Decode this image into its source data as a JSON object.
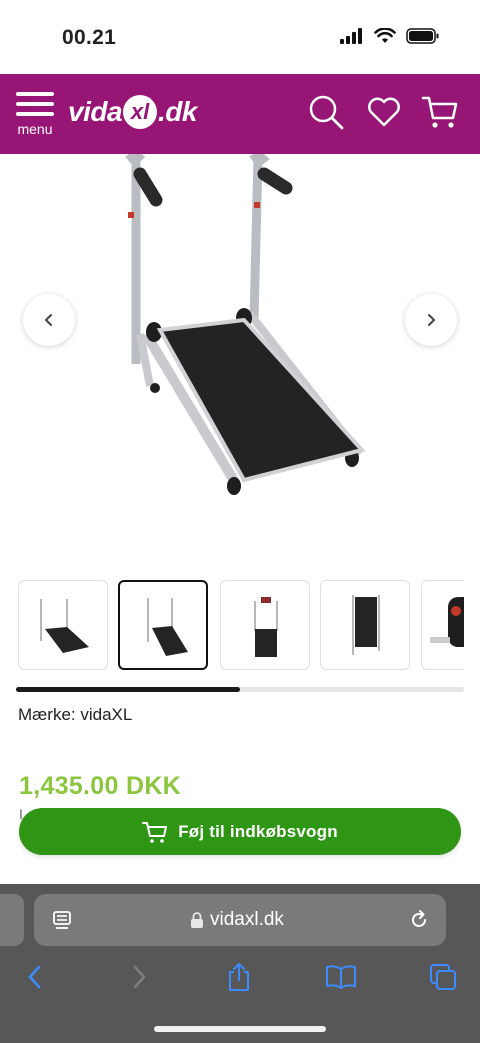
{
  "status_bar": {
    "time": "00.21"
  },
  "header": {
    "menu_label": "menu",
    "logo_text": "vidaXL.dk",
    "logo_prefix": "vida",
    "logo_mid": "xl",
    "logo_suffix": ".dk",
    "colors": {
      "background": "#971575",
      "foreground": "#ffffff"
    }
  },
  "gallery": {
    "thumbnail_count_visible": 5,
    "active_thumbnail_index": 1,
    "scroll_progress": 0.5
  },
  "product": {
    "brand_line": "Mærke: vidaXL",
    "price": "1,435.00 DKK",
    "price_note": "I…",
    "price_color": "#8cc63f"
  },
  "cart_button": {
    "label": "Føj til indkøbsvogn",
    "color": "#2f9515"
  },
  "browser": {
    "address": "vidaxl.dk"
  },
  "icons": [
    "signal-icon",
    "wifi-icon",
    "battery-icon",
    "hamburger-icon",
    "search-icon",
    "heart-icon",
    "cart-icon",
    "chevron-left-icon",
    "chevron-right-icon",
    "reader-icon",
    "lock-icon",
    "reload-icon",
    "back-icon",
    "forward-icon",
    "share-icon",
    "bookmarks-icon",
    "tabs-icon"
  ]
}
